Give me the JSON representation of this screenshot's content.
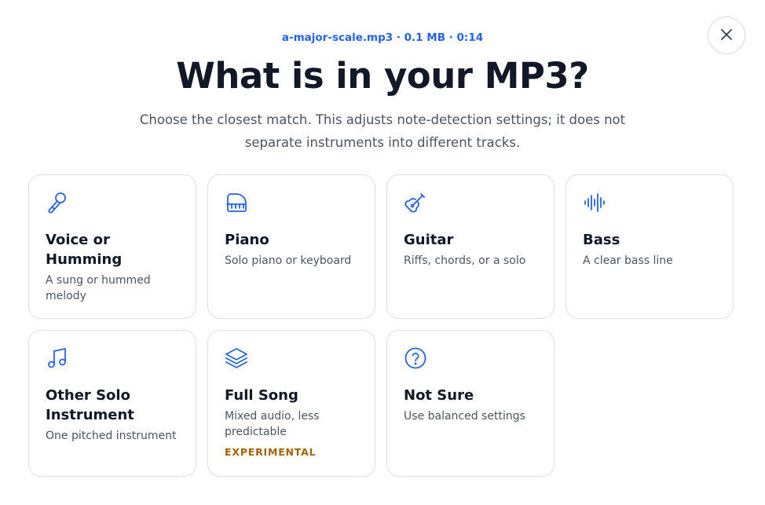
{
  "header": {
    "file_info": "a-major-scale.mp3 · 0.1 MB · 0:14",
    "title": "What is in your MP3?",
    "subtitle": "Choose the closest match. This adjusts note-detection settings; it does not separate instruments into different tracks.",
    "close_icon": "close-icon"
  },
  "options": [
    {
      "name": "Voice or Humming",
      "description": "A sung or hummed melody",
      "icon": "microphone-icon"
    },
    {
      "name": "Piano",
      "description": "Solo piano or keyboard",
      "icon": "piano-icon"
    },
    {
      "name": "Guitar",
      "description": "Riffs, chords, or a solo",
      "icon": "guitar-icon"
    },
    {
      "name": "Bass",
      "description": "A clear bass line",
      "icon": "waveform-icon"
    },
    {
      "name": "Other Solo Instrument",
      "description": "One pitched instrument",
      "icon": "music-note-icon"
    },
    {
      "name": "Full Song",
      "description": "Mixed audio, less predictable",
      "badge": "EXPERIMENTAL",
      "icon": "layers-icon"
    },
    {
      "name": "Not Sure",
      "description": "Use balanced settings",
      "icon": "question-icon"
    }
  ],
  "colors": {
    "accent": "#2563eb",
    "badge": "#a16207",
    "title": "#111827",
    "muted": "#4b5563",
    "border": "#dcdfe4"
  }
}
